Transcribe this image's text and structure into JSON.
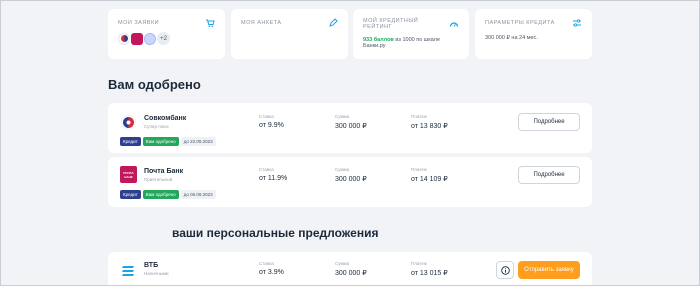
{
  "cards": {
    "applications": {
      "title": "МОИ ЗАЯВКИ",
      "more": "+2",
      "icon": "cart-icon"
    },
    "profile": {
      "title": "МОЯ АНКЕТА",
      "icon": "pencil-icon"
    },
    "rating": {
      "title": "МОЙ КРЕДИТНЫЙ РЕЙТИНГ",
      "score": "933 баллов",
      "suffix": " из 1000 по шкале Банки.ру",
      "icon": "gauge-icon"
    },
    "params": {
      "title": "ПАРАМЕТРЫ КРЕДИТА",
      "text": "300 000 ₽ на 24 мес.",
      "icon": "sliders-icon"
    }
  },
  "sections": {
    "approved": "Вам одобрено",
    "personal": "ваши персональные предложения"
  },
  "columns": {
    "rate": "Ставка",
    "sum": "Сумма",
    "payment": "Платеж"
  },
  "offers": [
    {
      "bank": "Совкомбанк",
      "subtitle": "Супер плюс",
      "tags": {
        "type": "Кредит",
        "status": "Вам одобрено",
        "date": "до 22.09.2023"
      },
      "rate": "от 9.9%",
      "sum": "300 000 ₽",
      "payment": "от 13 830 ₽",
      "button": "Подробнее"
    },
    {
      "bank": "Почта Банк",
      "subtitle": "Приятельный",
      "logo_text": "ПОЧТА БАНК",
      "tags": {
        "type": "Кредит",
        "status": "Вам одобрено",
        "date": "до 06.09.2023"
      },
      "rate": "от 11.9%",
      "sum": "300 000 ₽",
      "payment": "от 14 109 ₽",
      "button": "Подробнее"
    },
    {
      "bank": "ВТБ",
      "subtitle": "Наличными",
      "rate": "от 3.9%",
      "sum": "300 000 ₽",
      "payment": "от 13 015 ₽",
      "button": "Отправить заявку"
    }
  ],
  "colors": {
    "accent_orange": "#ff9d1c",
    "approved_green": "#22a75c",
    "credit_blue": "#2f3f8f",
    "icon_blue": "#1aa3e8"
  }
}
